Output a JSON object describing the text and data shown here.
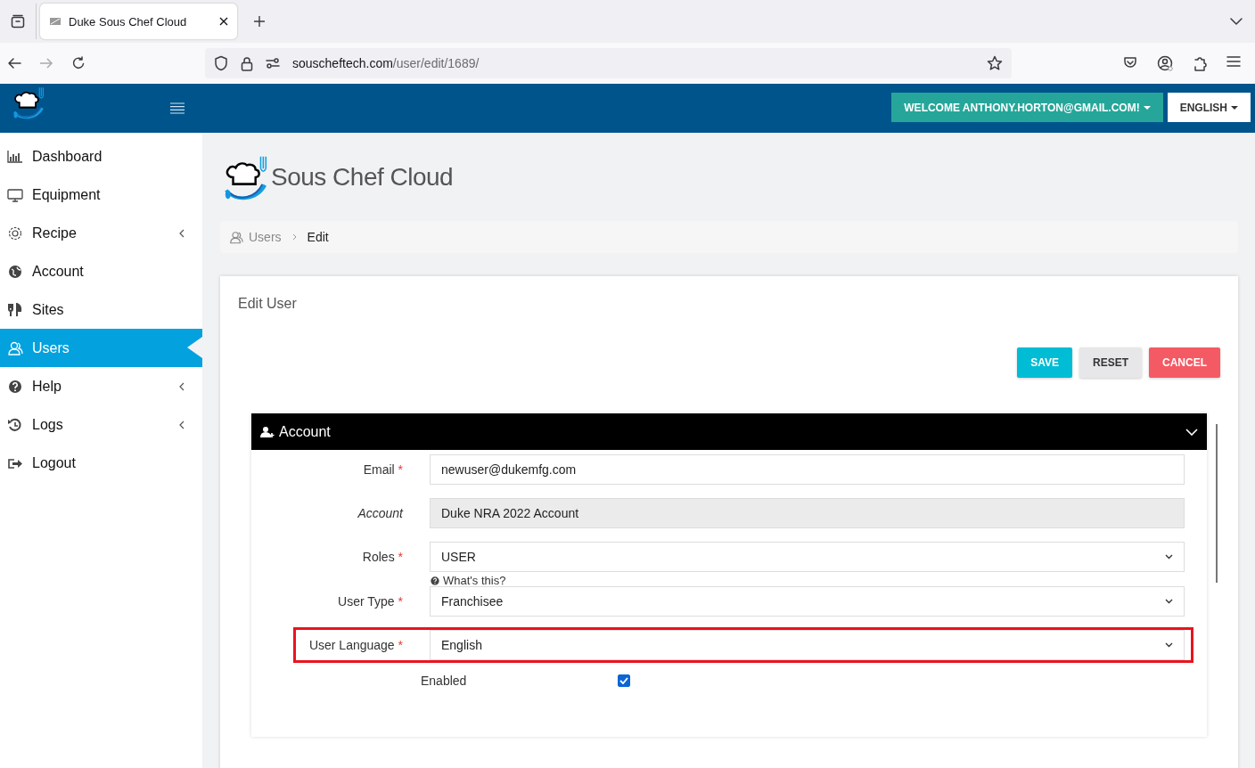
{
  "browser": {
    "tab_title": "Duke Sous Chef Cloud",
    "url_host": "souscheftech.com",
    "url_path": "/user/edit/1689/"
  },
  "header": {
    "welcome": "WELCOME ANTHONY.HORTON@GMAIL.COM!",
    "language": "ENGLISH"
  },
  "sidebar": {
    "items": [
      {
        "label": "Dashboard",
        "selected": false,
        "submenu": false
      },
      {
        "label": "Equipment",
        "selected": false,
        "submenu": false
      },
      {
        "label": "Recipe",
        "selected": false,
        "submenu": true
      },
      {
        "label": "Account",
        "selected": false,
        "submenu": false
      },
      {
        "label": "Sites",
        "selected": false,
        "submenu": false
      },
      {
        "label": "Users",
        "selected": true,
        "submenu": false
      },
      {
        "label": "Help",
        "selected": false,
        "submenu": true
      },
      {
        "label": "Logs",
        "selected": false,
        "submenu": true
      },
      {
        "label": "Logout",
        "selected": false,
        "submenu": false
      }
    ]
  },
  "brand": "Sous Chef Cloud",
  "breadcrumb": [
    {
      "label": "Users",
      "current": false
    },
    {
      "label": "Edit",
      "current": true
    }
  ],
  "card": {
    "title": "Edit User",
    "buttons": [
      {
        "label": "SAVE",
        "kind": "primary"
      },
      {
        "label": "RESET",
        "kind": "default"
      },
      {
        "label": "CANCEL",
        "kind": "danger"
      }
    ]
  },
  "section": {
    "title": "Account",
    "expanded": true,
    "fields": [
      {
        "label": "Email",
        "kind": "input",
        "value": "newuser@dukemfg.com",
        "marker": "*",
        "highlighted": false
      },
      {
        "label": "Account",
        "kind": "readonly",
        "value": "Duke NRA 2022 Account",
        "highlighted": false
      },
      {
        "label": "Roles",
        "kind": "select",
        "value": "USER",
        "marker": "*",
        "help": "What's this?",
        "highlighted": false
      },
      {
        "label": "User Type",
        "kind": "select",
        "value": "Franchisee",
        "marker": "*",
        "highlighted": false
      },
      {
        "label": "User Language",
        "kind": "select",
        "value": "English",
        "marker": "*",
        "highlighted": true
      },
      {
        "label": "Enabled",
        "kind": "checkbox",
        "checked": true,
        "highlighted": false
      }
    ]
  }
}
